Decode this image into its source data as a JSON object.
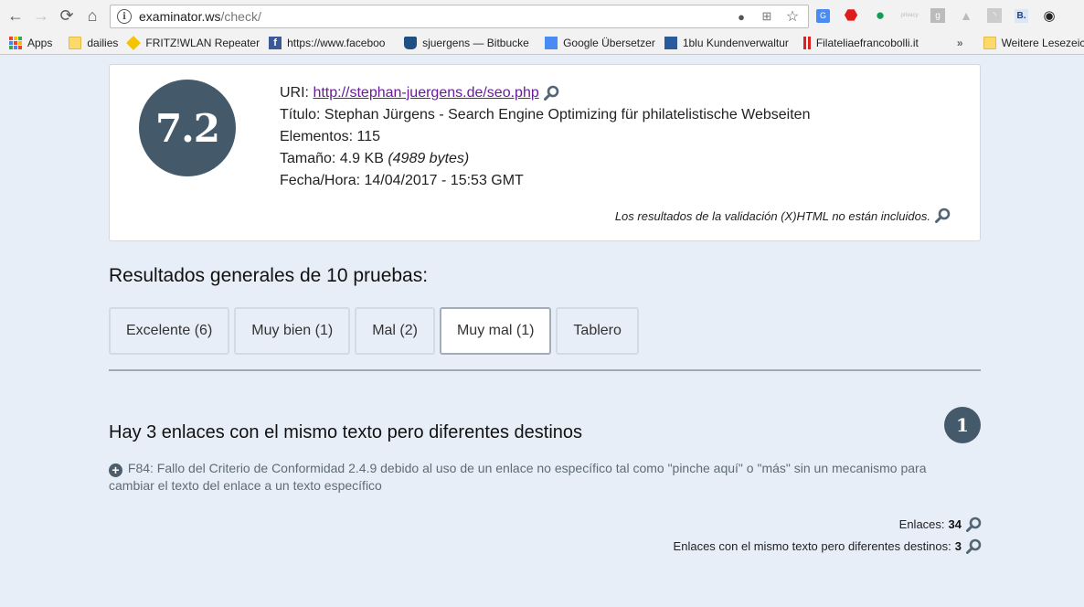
{
  "browser": {
    "url_host": "examinator.ws",
    "url_path": "/check/",
    "bookmarks": [
      {
        "label": "Apps",
        "icon": "apps-grid-icon"
      },
      {
        "label": "dailies",
        "icon": "folder-icon"
      },
      {
        "label": "FRITZ!WLAN Repeater",
        "icon": "fritz-icon"
      },
      {
        "label": "https://www.faceboo",
        "icon": "facebook-icon"
      },
      {
        "label": "sjuergens — Bitbucke",
        "icon": "bitbucket-icon"
      },
      {
        "label": "Google Übersetzer",
        "icon": "google-translate-icon"
      },
      {
        "label": "1blu Kundenverwaltur",
        "icon": "1blu-icon"
      },
      {
        "label": "Filateliaefrancobolli.it",
        "icon": "filatelia-icon"
      }
    ],
    "overflow_label": "»",
    "other_bookmarks": "Weitere Lesezeichen"
  },
  "summary": {
    "score": "7.2",
    "uri_label": "URI:",
    "uri": "http://stephan-juergens.de/seo.php",
    "title_label": "Título:",
    "title": "Stephan Jürgens - Search Engine Optimizing für philatelistische Webseiten",
    "elements_label": "Elementos:",
    "elements": "115",
    "size_label": "Tamaño:",
    "size": "4.9 KB",
    "size_bytes": "(4989 bytes)",
    "datetime_label": "Fecha/Hora:",
    "datetime": "14/04/2017 - 15:53 GMT",
    "note": "Los resultados de la validación (X)HTML no están incluidos."
  },
  "results": {
    "heading": "Resultados generales de 10 pruebas:",
    "tabs": [
      {
        "label": "Excelente (6)",
        "active": false
      },
      {
        "label": "Muy bien (1)",
        "active": false
      },
      {
        "label": "Mal (2)",
        "active": false
      },
      {
        "label": "Muy mal (1)",
        "active": true
      },
      {
        "label": "Tablero",
        "active": false
      }
    ]
  },
  "issue": {
    "title": "Hay 3 enlaces con el mismo texto pero diferentes destinos",
    "badge": "1",
    "description": "F84: Fallo del Criterio de Conformidad 2.4.9 debido al uso de un enlace no específico tal como \"pinche aquí\" o \"más\" sin un mecanismo para cambiar el texto del enlace a un texto específico",
    "stats": [
      {
        "label": "Enlaces:",
        "value": "34"
      },
      {
        "label": "Enlaces con el mismo texto pero diferentes destinos:",
        "value": "3"
      }
    ]
  },
  "colors": {
    "accent": "#445a6b",
    "page_bg": "#e8eef7",
    "link": "#6a1b9a"
  }
}
